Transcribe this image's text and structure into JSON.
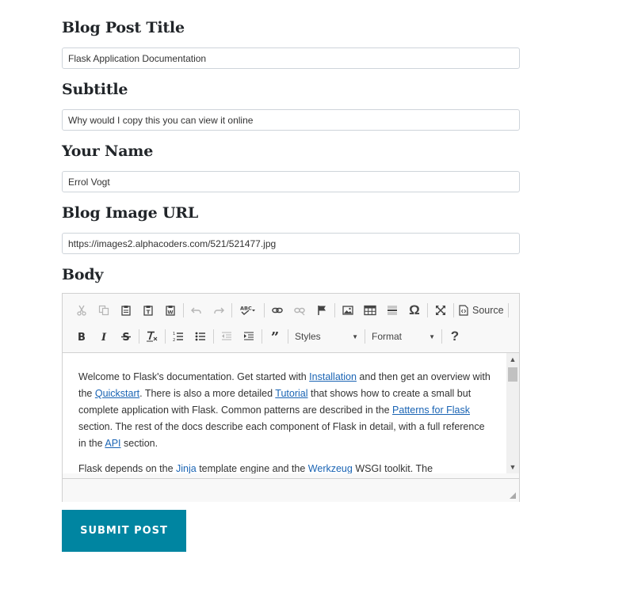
{
  "fields": {
    "title": {
      "label": "Blog Post Title",
      "value": "Flask Application Documentation"
    },
    "subtitle": {
      "label": "Subtitle",
      "value": "Why would I copy this you can view it online"
    },
    "name": {
      "label": "Your Name",
      "value": "Errol Vogt"
    },
    "image_url": {
      "label": "Blog Image URL",
      "value": "https://images2.alphacoders.com/521/521477.jpg"
    },
    "body": {
      "label": "Body"
    }
  },
  "toolbar": {
    "source_label": "Source",
    "styles_label": "Styles",
    "format_label": "Format",
    "help_label": "?",
    "omega_label": "Ω"
  },
  "content": {
    "p1": {
      "t1": "Welcome to Flask's documentation. Get started with ",
      "l1": "Installation",
      "t2": " and then get an overview with the ",
      "l2": "Quickstart",
      "t3": ". There is also a more detailed ",
      "l3": "Tutorial",
      "t4": " that shows how to create a small but complete application with Flask. Common patterns are described in the ",
      "l4": "Patterns for Flask",
      "t5": " section. The rest of the docs describe each component of Flask in detail, with a full reference in the ",
      "l5": "API",
      "t6": " section."
    },
    "p2": {
      "t1": "Flask depends on the ",
      "l1": "Jinja",
      "t2": " template engine and the ",
      "l2": "Werkzeug",
      "t3": " WSGI toolkit. The"
    }
  },
  "submit_label": "SUBMIT POST",
  "colors": {
    "accent": "#0085a1",
    "link": "#1a64b4"
  }
}
